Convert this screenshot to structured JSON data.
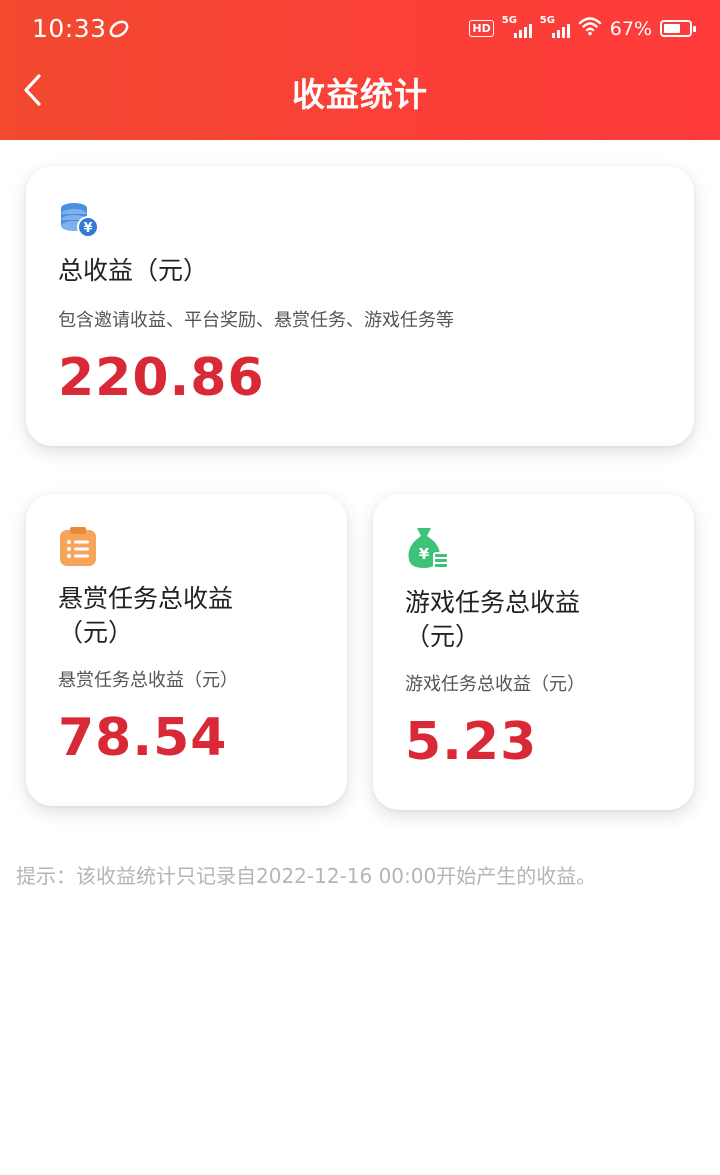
{
  "status_bar": {
    "time": "10:33",
    "battery": "67%",
    "battery_level": 0.67,
    "hd_label": "HD",
    "network_labels": [
      "5G",
      "5G"
    ]
  },
  "nav": {
    "back_icon": "chevron-left-icon",
    "title": "收益统计"
  },
  "colors": {
    "header_gradient_start": "#f2492f",
    "header_gradient_end": "#ff3b3b",
    "value_red": "#d92836",
    "tip_gray": "#b5b5b5",
    "coin_blue": "#4a8fe0",
    "clipboard_orange": "#f5a45a",
    "money_bag_green": "#3ec27a"
  },
  "total_card": {
    "icon": "coins-icon",
    "title": "总收益（元）",
    "subtitle": "包含邀请收益、平台奖励、悬赏任务、游戏任务等",
    "value": "220.86"
  },
  "bounty_card": {
    "icon": "clipboard-icon",
    "title_line1": "悬赏任务总收益",
    "title_line2": "（元）",
    "subtitle": "悬赏任务总收益（元）",
    "value": "78.54"
  },
  "game_card": {
    "icon": "money-bag-icon",
    "title_line1": "游戏任务总收益",
    "title_line2": "（元）",
    "subtitle": "游戏任务总收益（元）",
    "value": "5.23"
  },
  "tip": "提示：该收益统计只记录自2022-12-16 00:00开始产生的收益。"
}
